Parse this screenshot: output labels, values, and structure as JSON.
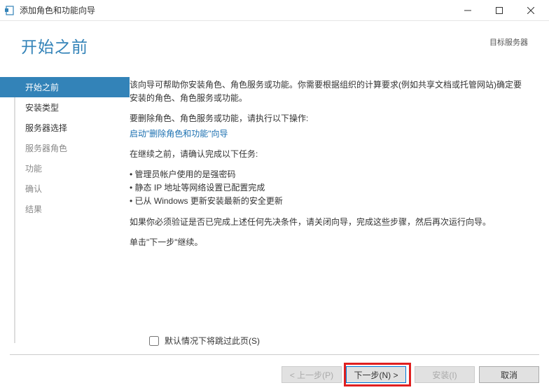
{
  "window": {
    "title": "添加角色和功能向导"
  },
  "header": {
    "page_title": "开始之前",
    "target_label": "目标服务器"
  },
  "sidebar": {
    "items": [
      {
        "label": "开始之前",
        "state": "active"
      },
      {
        "label": "安装类型",
        "state": "enabled"
      },
      {
        "label": "服务器选择",
        "state": "enabled"
      },
      {
        "label": "服务器角色",
        "state": "disabled"
      },
      {
        "label": "功能",
        "state": "disabled"
      },
      {
        "label": "确认",
        "state": "disabled"
      },
      {
        "label": "结果",
        "state": "disabled"
      }
    ]
  },
  "content": {
    "intro": "该向导可帮助你安装角色、角色服务或功能。你需要根据组织的计算要求(例如共享文档或托管网站)确定要安装的角色、角色服务或功能。",
    "remove_label": "要删除角色、角色服务或功能，请执行以下操作:",
    "remove_link": "启动\"删除角色和功能\"向导",
    "pre_tasks_label": "在继续之前，请确认完成以下任务:",
    "tasks": [
      "管理员帐户使用的是强密码",
      "静态 IP 地址等网络设置已配置完成",
      "已从 Windows 更新安装最新的安全更新"
    ],
    "verify_note": "如果你必须验证是否已完成上述任何先决条件，请关闭向导，完成这些步骤，然后再次运行向导。",
    "continue_note": "单击\"下一步\"继续。"
  },
  "skip": {
    "label": "默认情况下将跳过此页(S)"
  },
  "footer": {
    "prev": "< 上一步(P)",
    "next": "下一步(N) >",
    "install": "安装(I)",
    "cancel": "取消"
  }
}
